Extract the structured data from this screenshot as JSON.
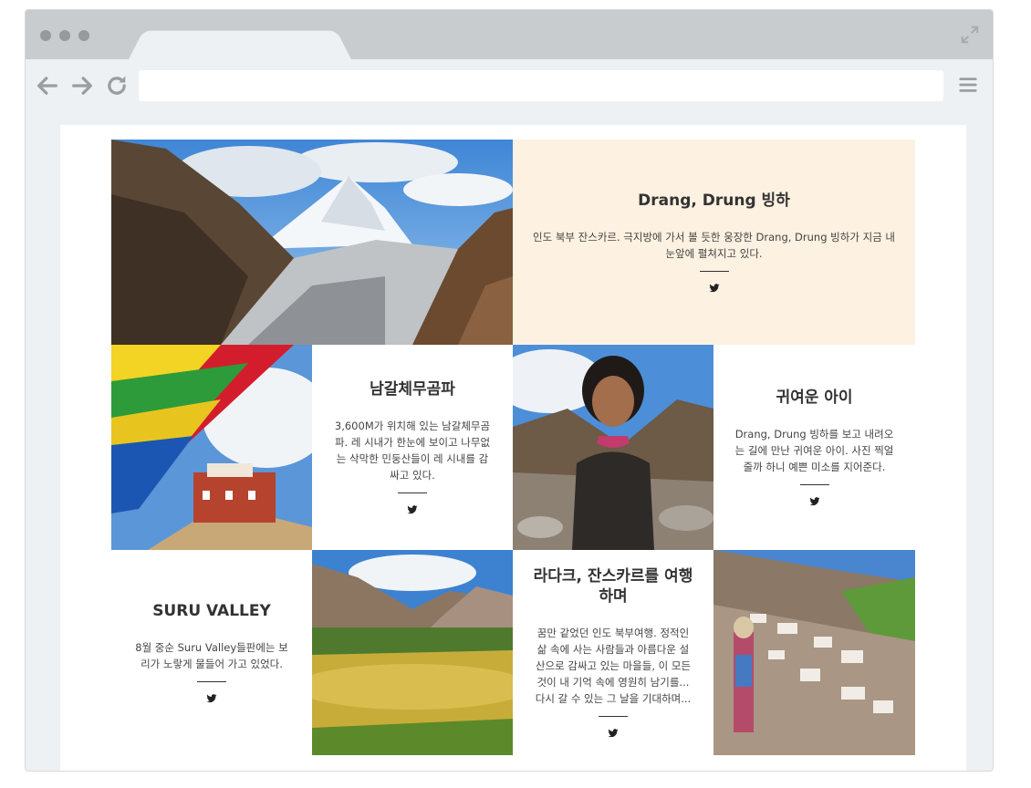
{
  "browser": {
    "address_value": "",
    "icons": [
      "back-arrow-icon",
      "forward-arrow-icon",
      "reload-icon",
      "hamburger-menu-icon",
      "expand-icon"
    ]
  },
  "cards": {
    "drang": {
      "title": "Drang, Drung 빙하",
      "body": "인도 북부 잔스카르. 극지방에 가서 볼 듯한 웅장한 Drang, Drung 빙하가 지금 내 눈앞에 펼쳐지고 있다."
    },
    "namgyal": {
      "title": "남갈체무곰파",
      "body": "3,600M가 위치해 있는 남갈체무곰파. 레 시내가 한눈에 보이고 나무없는 삭막한 민둥산들이 레 시내를 감싸고 있다."
    },
    "child": {
      "title": "귀여운 아이",
      "body": "Drang, Drung 빙하를 보고 내려오는 길에 만난 귀여운 아이. 사진 찍얼 줄까 하니 예쁜 미소를 지어준다."
    },
    "suru": {
      "title": "SURU VALLEY",
      "body": "8월 중순 Suru Valley들판에는 보리가 노랗게 물들어 가고 있었다."
    },
    "ladakh": {
      "title": "라다크, 잔스카르를 여행하며",
      "body": "꿈만 같었던 인도 북부여행. 정적인 삶 속에 사는 사람들과 아름다운 설산으로 감싸고 있는 마을들, 이 모든 것이 내 기억 속에 영원히 남기를... 다시 갈 수 있는 그 날을 기대하며..."
    }
  },
  "colors": {
    "featured_bg": "#fdf1e1",
    "frame_bg": "#eef1f4",
    "titlebar": "#c9ccce"
  }
}
